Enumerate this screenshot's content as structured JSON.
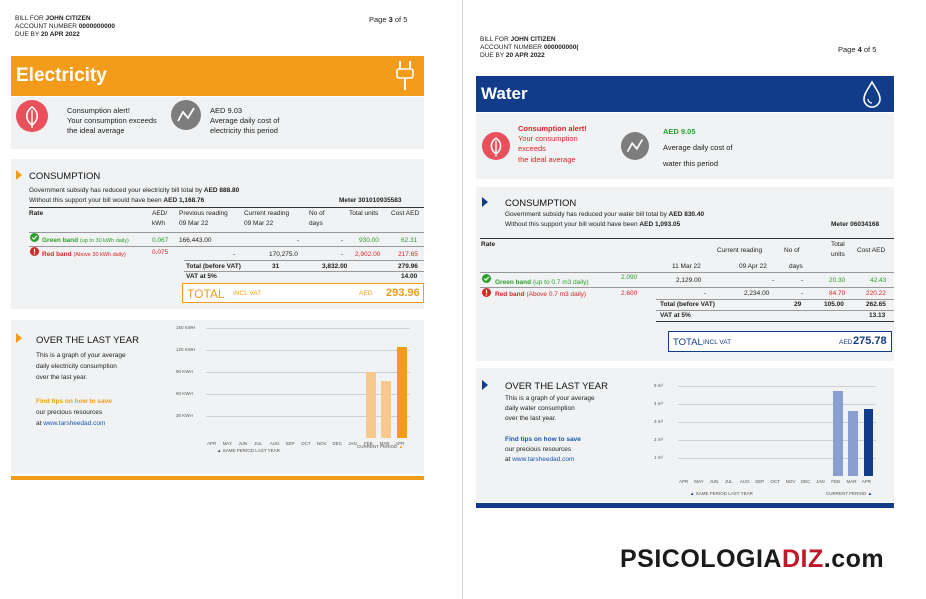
{
  "elec": {
    "bill_for_label": "BILL FOR",
    "customer": "JOHN CITIZEN",
    "account_label": "ACCOUNT NUMBER",
    "account": "0000000000",
    "due_label": "DUE BY",
    "due": "20 APR 2022",
    "page_label": "Page",
    "page": "3",
    "of": "of",
    "pages": "5",
    "title": "Electricity",
    "alert1": "Consumption alert!",
    "alert2": "Your consumption exceeds",
    "alert3": "the ideal average",
    "avg_val": "AED 9.03",
    "avg1": "Average daily cost of",
    "avg2": "electricity this period",
    "consumption_title": "CONSUMPTION",
    "subsidy1_pre": "Government subsidy has reduced your electricity bill total by",
    "subsidy1_val": "AED 888.80",
    "subsidy2_pre": "Without this support your bill would have been",
    "subsidy2_val": "AED 1,168.76",
    "meter": "Meter 301010935583",
    "headers": {
      "rate": "Rate",
      "aed": "AED/",
      "kwh": "kWh",
      "prev": "Previous reading",
      "prev_date": "09 Mar 22",
      "curr": "Current reading",
      "curr_date": "09 Mar 22",
      "days1": "No of",
      "days2": "days",
      "units": "Total units",
      "cost": "Cost AED"
    },
    "green": {
      "label": "Green band",
      "range": "(up to 30 kWh daily)",
      "rate": "0.067",
      "prev": "166,443.00",
      "curr": "-",
      "days": "-",
      "units": "930.00",
      "cost": "62.31"
    },
    "red": {
      "label": "Red band",
      "range": "(Above 30 kWh daily)",
      "rate": "0.075",
      "prev": "-",
      "curr": "170,275.0",
      "days": "-",
      "units": "2,902.00",
      "cost": "217.65"
    },
    "total_before_label": "Total (before VAT)",
    "total_before_days": "31",
    "total_before_units": "3,832.00",
    "total_before_cost": "279.96",
    "vat_label": "VAT at 5%",
    "vat_cost": "14.00",
    "total_label": "TOTAL",
    "incl_vat": "INCL VAT",
    "total_cur": "AED",
    "total_val": "293.96",
    "year_title": "OVER THE LAST YEAR",
    "year1": "This is a graph of your average",
    "year2": "daily electricity consumption",
    "year3": "over the last year.",
    "tips": "Find tips on how to save",
    "tips2": "our precious resources",
    "tips3_pre": "at",
    "tips_link": "www.tarsheedad.com",
    "legend_same": "SAME PERIOD LAST YEAR",
    "legend_curr": "CURRENT PERIOD"
  },
  "water": {
    "bill_for_label": "BILL FOR",
    "customer": "JOHN CITIZEN",
    "account_label": "ACCOUNT NUMBER",
    "account": "000000000(",
    "due_label": "DUE BY",
    "due": "20 APR 2022",
    "page_label": "Page",
    "page": "4",
    "of": "of",
    "pages": "5",
    "title": "Water",
    "alert1": "Consumption alert!",
    "alert2": "Your consumption",
    "alert3": "exceeds",
    "alert4": "the ideal average",
    "avg_val": "AED 9.05",
    "avg1": "Average daily cost of",
    "avg2": "water this period",
    "consumption_title": "CONSUMPTION",
    "subsidy1_pre": "Government subsidy has reduced your water bill total by",
    "subsidy1_val": "AED 830.40",
    "subsidy2_pre": "Without this support your bill would have been",
    "subsidy2_val": "AED 1,093.05",
    "meter": "Meter 06034168",
    "headers": {
      "rate": "Rate",
      "curr": "Current reading",
      "days1": "No of",
      "days2": "days",
      "units1": "Total",
      "units2": "units",
      "cost": "Cost AED",
      "prev_date": "11 Mar 22",
      "curr_date": "09 Apr 22"
    },
    "green": {
      "label": "Green band",
      "range": "(up to 0.7 m3 daily)",
      "rate": "2.090",
      "prev": "2,129.00",
      "curr": "-",
      "days": "-",
      "units": "20.30",
      "cost": "42.43"
    },
    "red": {
      "label": "Red band",
      "range": "(Above 0.7 m3 daily)",
      "rate": "2.600",
      "prev": "-",
      "curr": "2,234.00",
      "days": "-",
      "units": "84.70",
      "cost": "220.22"
    },
    "total_before_label": "Total (before VAT)",
    "total_before_days": "29",
    "total_before_units": "105.00",
    "total_before_cost": "262.65",
    "vat_label": "VAT at 5%",
    "vat_cost": "13.13",
    "total_label": "TOTAL",
    "incl_vat": "INCL VAT",
    "total_cur": "AED",
    "total_val": "275.78",
    "year_title": "OVER THE LAST YEAR",
    "year1": "This is a graph of your average",
    "year2": "daily water consumption",
    "year3": "over the last year.",
    "tips": "Find tips on how to save",
    "tips2": "our precious resources",
    "tips3_pre": "at",
    "tips_link": "www.tarsheedad.com",
    "legend_same": "SAME PERIOD LAST YEAR",
    "legend_curr": "CURRENT PERIOD"
  },
  "watermark": {
    "part1": "PSICOLOGIA",
    "part2": "DIZ",
    "part3": ".com"
  },
  "colors": {
    "electricity_accent": "#f39c1b",
    "water_accent": "#123b8a",
    "alert_red": "#e8505b"
  },
  "icons": [
    "plug-icon",
    "water-drop-icon",
    "leaf-icon",
    "gauge-icon",
    "check-circle-icon",
    "exclamation-circle-icon",
    "triangle-marker-icon"
  ],
  "chart_data": [
    {
      "type": "bar",
      "categories": [
        "APR",
        "MAY",
        "JUN",
        "JUL",
        "AUG",
        "SEP",
        "OCT",
        "NOV",
        "DEC",
        "JAN",
        "FEB",
        "MAR",
        "APR"
      ],
      "ytick_labels": [
        "150 KWH",
        "120 KWH",
        "90 KWH",
        "60 KWH",
        "30 KWH"
      ],
      "ylim": [
        0,
        150
      ],
      "series": [
        {
          "name": "SAME PERIOD LAST YEAR",
          "values": [
            0,
            0,
            0,
            0,
            0,
            0,
            0,
            0,
            0,
            0,
            90,
            78,
            0
          ]
        },
        {
          "name": "CURRENT PERIOD",
          "values": [
            0,
            0,
            0,
            0,
            0,
            0,
            0,
            0,
            0,
            0,
            0,
            0,
            124
          ]
        }
      ]
    },
    {
      "type": "bar",
      "categories": [
        "APR",
        "MAY",
        "JUN",
        "JUL",
        "AUG",
        "SEP",
        "OCT",
        "NOV",
        "DEC",
        "JAN",
        "FEB",
        "MAR",
        "APR"
      ],
      "ytick_labels": [
        "5 m³",
        "4 m³",
        "3 m³",
        "2 m³",
        "1 m³"
      ],
      "ylim": [
        0,
        5
      ],
      "series": [
        {
          "name": "SAME PERIOD LAST YEAR",
          "values": [
            0,
            0,
            0,
            0,
            0,
            0,
            0,
            0,
            0,
            0,
            4.7,
            3.6,
            0
          ]
        },
        {
          "name": "CURRENT PERIOD",
          "values": [
            0,
            0,
            0,
            0,
            0,
            0,
            0,
            0,
            0,
            0,
            0,
            0,
            3.7
          ]
        }
      ]
    }
  ]
}
